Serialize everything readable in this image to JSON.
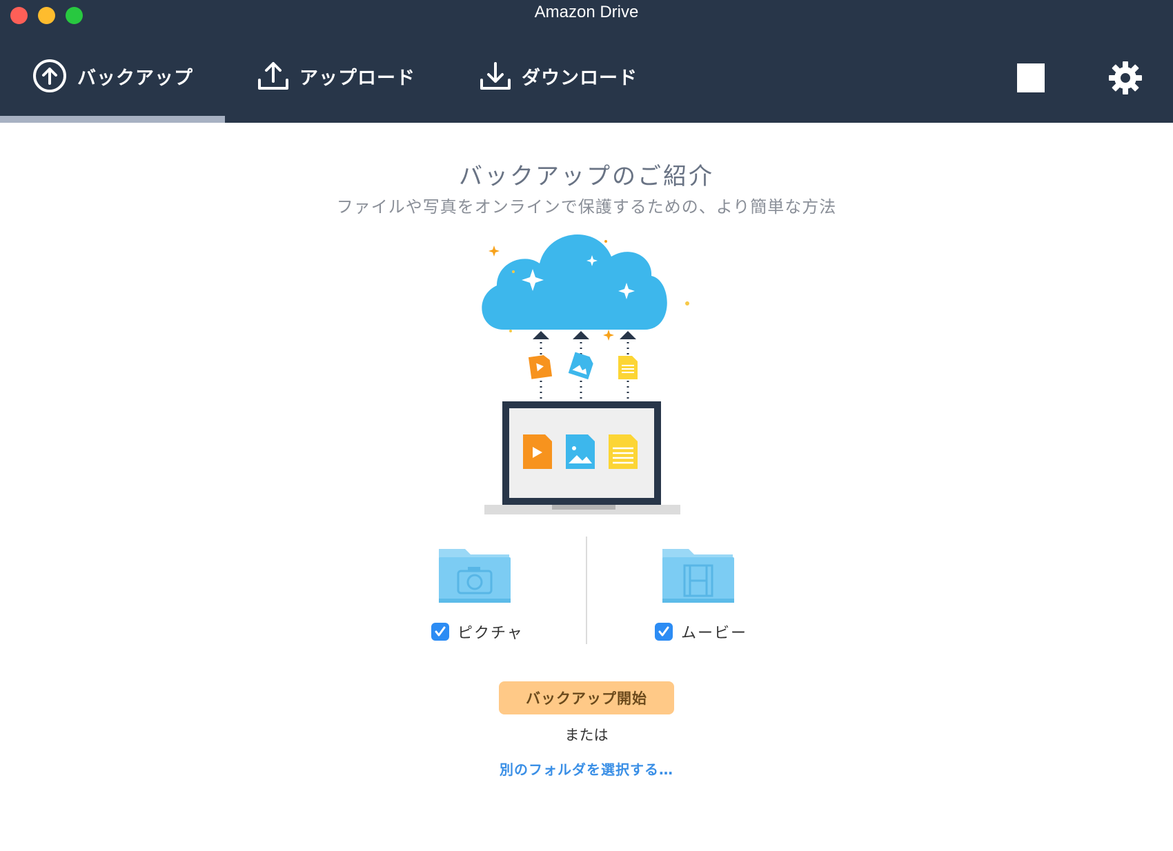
{
  "window": {
    "title": "Amazon Drive"
  },
  "tabs": [
    {
      "label": "バックアップ",
      "icon": "backup-upload-circle-icon",
      "active": true
    },
    {
      "label": "アップロード",
      "icon": "upload-tray-icon",
      "active": false
    },
    {
      "label": "ダウンロード",
      "icon": "download-tray-icon",
      "active": false
    }
  ],
  "toolbar": {
    "pause_icon": "pause-icon",
    "settings_icon": "gear-icon"
  },
  "intro": {
    "title": "バックアップのご紹介",
    "subtitle": "ファイルや写真をオンラインで保護するための、より簡単な方法"
  },
  "folders": [
    {
      "label": "ピクチャ",
      "checked": true,
      "icon": "camera-folder-icon"
    },
    {
      "label": "ムービー",
      "checked": true,
      "icon": "film-folder-icon"
    }
  ],
  "actions": {
    "start_backup": "バックアップ開始",
    "or": "または",
    "choose_other": "別のフォルダを選択する…"
  },
  "colors": {
    "header_bg": "#283649",
    "accent_blue": "#3a8fe6",
    "button_orange": "#ffc987",
    "cloud_blue": "#3db7ec"
  }
}
